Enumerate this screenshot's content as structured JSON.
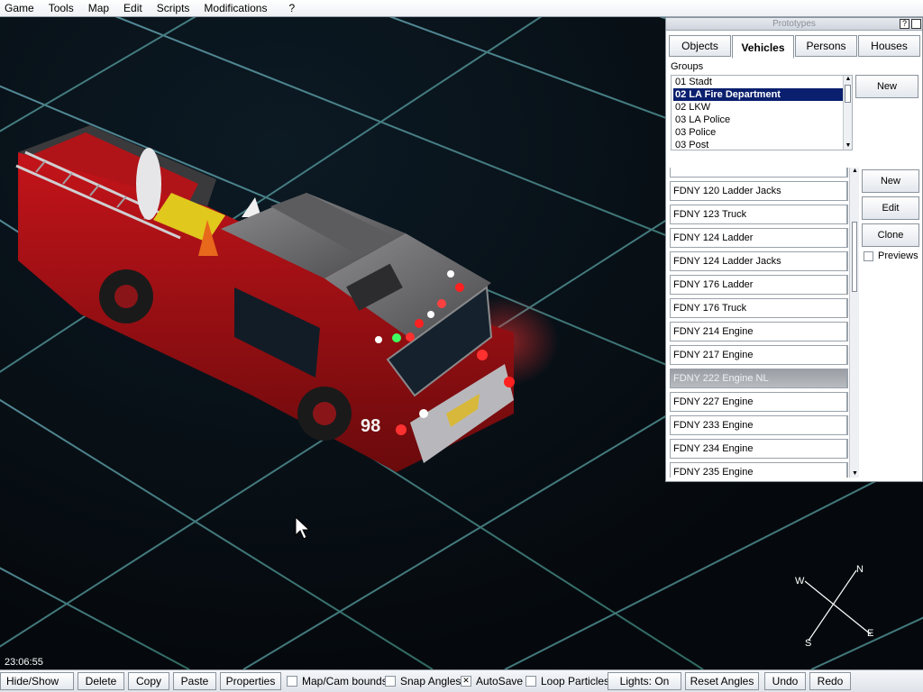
{
  "menu": [
    "Game",
    "Tools",
    "Map",
    "Edit",
    "Scripts",
    "Modifications",
    "?"
  ],
  "prototypes": {
    "title": "Prototypes",
    "help_glyph": "?",
    "tabs": [
      {
        "label": "Objects",
        "active": false
      },
      {
        "label": "Vehicles",
        "active": true
      },
      {
        "label": "Persons",
        "active": false
      },
      {
        "label": "Houses",
        "active": false
      }
    ],
    "groups_label": "Groups",
    "groups": [
      "01 Stadt",
      "02 LA Fire Department",
      "02 LKW",
      "03 LA Police",
      "03 Police",
      "03 Post"
    ],
    "selected_group": "02 LA Fire Department",
    "groups_new_label": "New",
    "vehicles": [
      "FDNY 120 Ladder Jacks",
      "FDNY 123 Truck",
      "FDNY 124 Ladder",
      "FDNY 124 Ladder Jacks",
      "FDNY 176 Ladder",
      "FDNY 176 Truck",
      "FDNY 214 Engine",
      "FDNY 217 Engine",
      "FDNY 222 Engine NL",
      "FDNY 227 Engine",
      "FDNY 233 Engine",
      "FDNY 234 Engine",
      "FDNY 235 Engine"
    ],
    "selected_vehicle": "FDNY 222 Engine NL",
    "buttons": {
      "new": "New",
      "edit": "Edit",
      "clone": "Clone"
    },
    "previews_label": "Previews"
  },
  "clock": "23:06:55",
  "compass": {
    "n": "N",
    "e": "E",
    "s": "S",
    "w": "W"
  },
  "toolbar": {
    "hide_show": "Hide/Show",
    "delete": "Delete",
    "copy": "Copy",
    "paste": "Paste",
    "properties": "Properties",
    "map_cam_bounds": "Map/Cam bounds",
    "snap_angles": "Snap Angles",
    "autosave": "AutoSave",
    "autosave_checked": true,
    "loop_particles": "Loop Particles",
    "lights": "Lights: On",
    "reset_angles": "Reset Angles",
    "undo": "Undo",
    "redo": "Redo"
  },
  "vehicle_number": "98"
}
